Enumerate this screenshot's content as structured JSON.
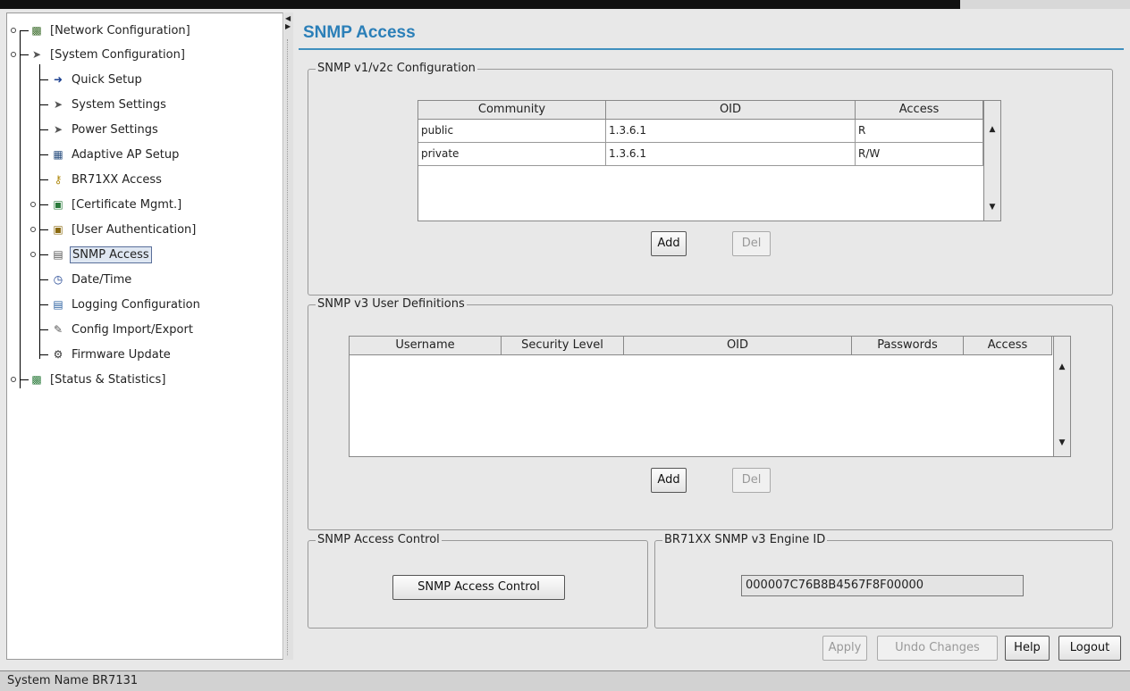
{
  "tree": {
    "items": [
      {
        "label": "[Network Configuration]",
        "icon": "network-icon"
      },
      {
        "label": "[System Configuration]",
        "icon": "plug-icon"
      },
      {
        "label": "Quick Setup",
        "icon": "arrow-right-icon"
      },
      {
        "label": "System Settings",
        "icon": "plug-icon"
      },
      {
        "label": "Power Settings",
        "icon": "plug-icon"
      },
      {
        "label": "Adaptive AP Setup",
        "icon": "access-points-icon"
      },
      {
        "label": "BR71XX Access",
        "icon": "key-icon"
      },
      {
        "label": "[Certificate Mgmt.]",
        "icon": "certificate-icon"
      },
      {
        "label": "[User Authentication]",
        "icon": "user-key-icon"
      },
      {
        "label": "SNMP Access",
        "icon": "snmp-key-icon"
      },
      {
        "label": "Date/Time",
        "icon": "clock-icon"
      },
      {
        "label": "Logging Configuration",
        "icon": "log-icon"
      },
      {
        "label": "Config Import/Export",
        "icon": "import-export-icon"
      },
      {
        "label": "Firmware Update",
        "icon": "firmware-icon"
      },
      {
        "label": "[Status & Statistics]",
        "icon": "chart-icon"
      }
    ],
    "selected": "SNMP Access"
  },
  "main": {
    "title": "SNMP Access",
    "v1v2c": {
      "legend": "SNMP v1/v2c Configuration",
      "columns": [
        "Community",
        "OID",
        "Access"
      ],
      "rows": [
        [
          "public",
          "1.3.6.1",
          "R"
        ],
        [
          "private",
          "1.3.6.1",
          "R/W"
        ]
      ],
      "add_label": "Add",
      "del_label": "Del"
    },
    "v3": {
      "legend": "SNMP v3 User Definitions",
      "columns": [
        "Username",
        "Security Level",
        "OID",
        "Passwords",
        "Access"
      ],
      "rows": [],
      "add_label": "Add",
      "del_label": "Del"
    },
    "access_control": {
      "legend": "SNMP Access Control",
      "button_label": "SNMP Access Control"
    },
    "engine_id": {
      "legend": "BR71XX SNMP v3 Engine ID",
      "value": "000007C76B8B4567F8F00000"
    },
    "footer": {
      "apply_label": "Apply",
      "undo_label": "Undo Changes",
      "help_label": "Help",
      "logout_label": "Logout"
    }
  },
  "status_bar": {
    "text": "System Name BR7131"
  }
}
